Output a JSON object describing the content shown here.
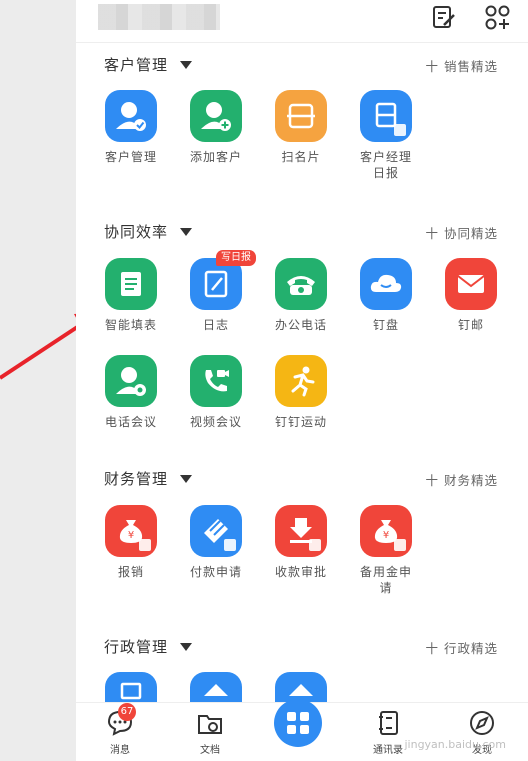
{
  "sections": [
    {
      "title": "客户管理",
      "link": "十 销售精选",
      "apps": [
        {
          "label": "客户管理",
          "color": "#2f8cf3",
          "icon": "person-check-icon"
        },
        {
          "label": "添加客户",
          "color": "#23b06e",
          "icon": "person-add-icon"
        },
        {
          "label": "扫名片",
          "color": "#f5a340",
          "icon": "card-scan-icon"
        },
        {
          "label": "客户经理日报",
          "color": "#2f8cf3",
          "icon": "daily-report-icon"
        }
      ]
    },
    {
      "title": "协同效率",
      "link": "十 协同精选",
      "apps": [
        {
          "label": "智能填表",
          "color": "#23b06e",
          "icon": "form-icon"
        },
        {
          "label": "日志",
          "color": "#2f8cf3",
          "icon": "log-icon",
          "badge": "写日报"
        },
        {
          "label": "办公电话",
          "color": "#23b06e",
          "icon": "phone-icon"
        },
        {
          "label": "钉盘",
          "color": "#2f8cf3",
          "icon": "cloud-icon"
        },
        {
          "label": "钉邮",
          "color": "#f0453a",
          "icon": "mail-icon"
        },
        {
          "label": "电话会议",
          "color": "#23b06e",
          "icon": "conference-call-icon"
        },
        {
          "label": "视频会议",
          "color": "#23b06e",
          "icon": "video-call-icon"
        },
        {
          "label": "钉钉运动",
          "color": "#f5b614",
          "icon": "running-icon"
        }
      ]
    },
    {
      "title": "财务管理",
      "link": "十 财务精选",
      "apps": [
        {
          "label": "报销",
          "color": "#f0453a",
          "icon": "money-bag-icon"
        },
        {
          "label": "付款申请",
          "color": "#2f8cf3",
          "icon": "payment-icon"
        },
        {
          "label": "收款审批",
          "color": "#f0453a",
          "icon": "receive-icon"
        },
        {
          "label": "备用金申请",
          "color": "#f0453a",
          "icon": "reserve-fund-icon"
        }
      ]
    },
    {
      "title": "行政管理",
      "link": "十 行政精选",
      "apps": [
        {
          "label": "",
          "color": "#2f8cf3",
          "icon": "admin-icon"
        },
        {
          "label": "",
          "color": "#2f8cf3",
          "icon": "admin-icon"
        },
        {
          "label": "",
          "color": "#2f8cf3",
          "icon": "admin-icon"
        }
      ]
    }
  ],
  "bottom_tabs": [
    {
      "label": "消息",
      "icon": "chat-icon",
      "count": "67"
    },
    {
      "label": "文档",
      "icon": "folder-icon"
    },
    {
      "label": "",
      "icon": "apps-grid-icon"
    },
    {
      "label": "通讯录",
      "icon": "contacts-icon"
    },
    {
      "label": "发现",
      "icon": "compass-icon"
    }
  ],
  "watermark": "jingyan.baidu.com",
  "colors": {
    "accent": "#2f8cf3",
    "arrow": "#e8232a"
  }
}
